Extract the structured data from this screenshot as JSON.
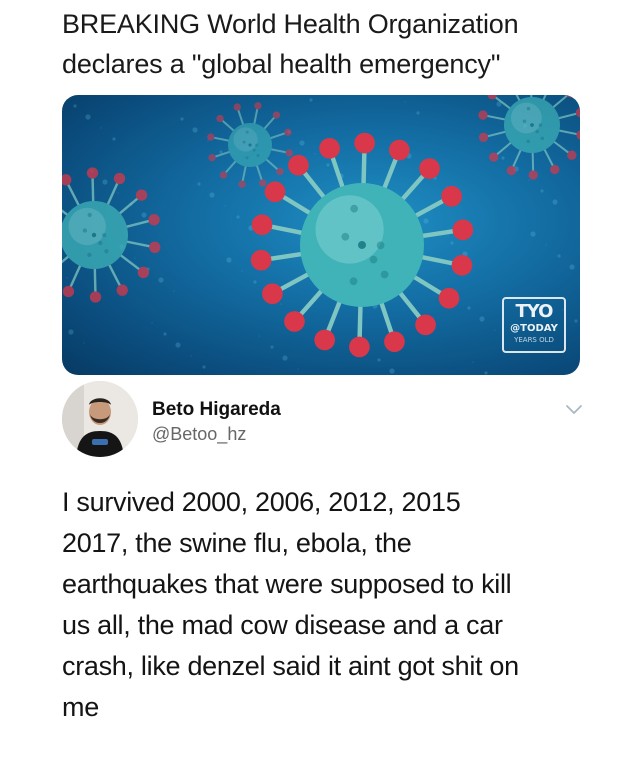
{
  "headline": {
    "line1": "BREAKING World Health Organization",
    "line2": "declares a \"global health emergency\""
  },
  "hero_image": {
    "watermark_line1": "TYO",
    "watermark_line2": "@TODAY",
    "watermark_line3": "YEARS OLD"
  },
  "tweet": {
    "author_name": "Beto Higareda",
    "author_handle": "@Betoo_hz",
    "text_lines": [
      "I survived 2000, 2006, 2012, 2015",
      "2017, the swine flu, ebola, the",
      "earthquakes that were supposed to kill",
      "us all, the mad cow disease and a car",
      "crash, like denzel said it aint got shit on",
      "me"
    ]
  },
  "icons": {
    "menu": "chevron-down-icon"
  },
  "colors": {
    "virus_body": "#3fb3b8",
    "virus_spike": "#d9374a",
    "background_blue": "#136da3"
  }
}
